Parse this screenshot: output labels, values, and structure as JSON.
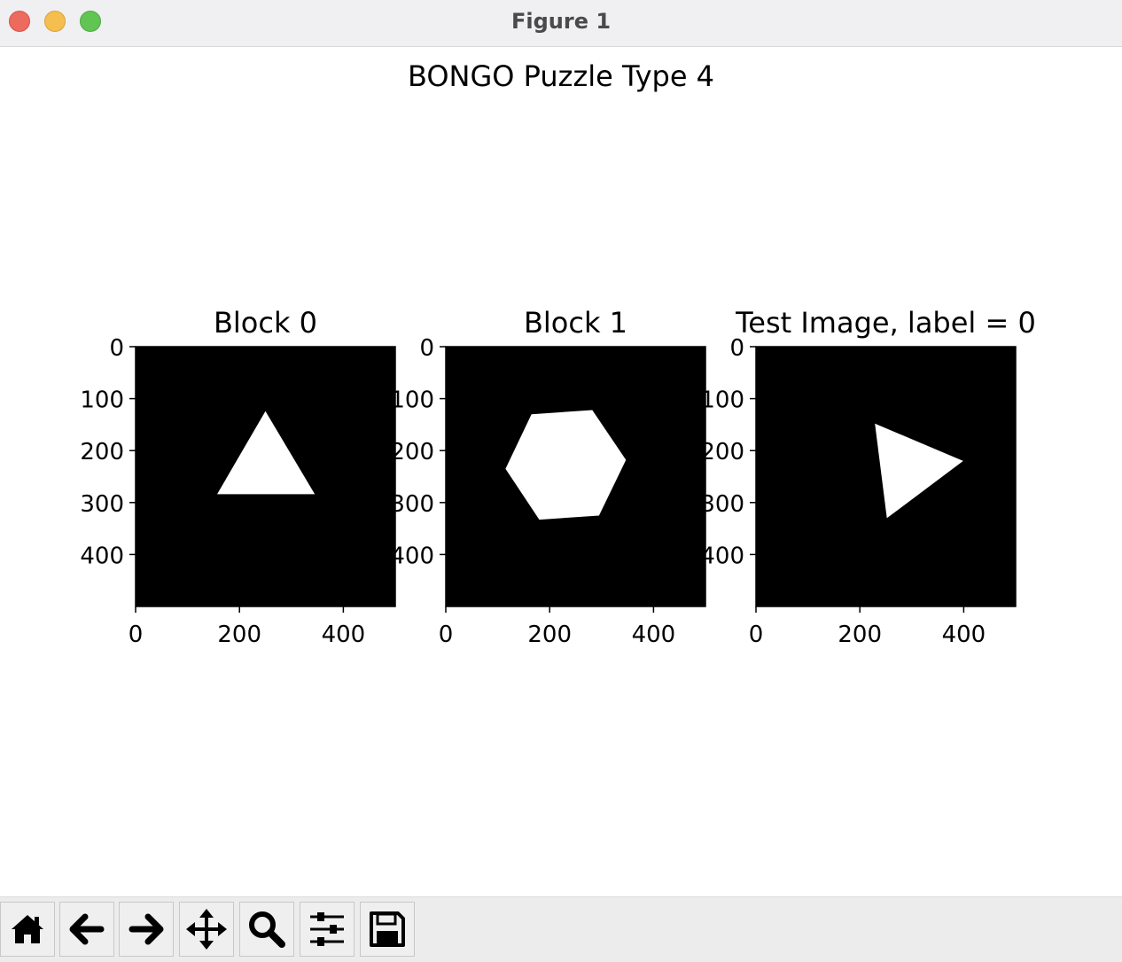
{
  "window": {
    "title": "Figure 1"
  },
  "figure": {
    "suptitle": "BONGO Puzzle Type 4",
    "panels": [
      {
        "title": "Block 0",
        "shape": "triangle-up",
        "polygon": [
          [
            250,
            124
          ],
          [
            345,
            284
          ],
          [
            157,
            284
          ]
        ]
      },
      {
        "title": "Block 1",
        "shape": "hexagon",
        "polygon": [
          [
            165,
            130
          ],
          [
            282,
            122
          ],
          [
            347,
            218
          ],
          [
            295,
            325
          ],
          [
            180,
            333
          ],
          [
            115,
            235
          ]
        ]
      },
      {
        "title": "Test Image, label = 0",
        "shape": "triangle-right",
        "polygon": [
          [
            229,
            148
          ],
          [
            399,
            220
          ],
          [
            252,
            330
          ]
        ]
      }
    ],
    "xticks": [
      "0",
      "200",
      "400"
    ],
    "yticks": [
      "0",
      "100",
      "200",
      "300",
      "400"
    ],
    "image_size": [
      500,
      500
    ],
    "colors": {
      "background": "#000000",
      "shape": "#ffffff"
    }
  },
  "chart_data": [
    {
      "type": "image",
      "title": "Block 0",
      "xlim": [
        0,
        500
      ],
      "ylim": [
        500,
        0
      ],
      "x_ticks": [
        0,
        200,
        400
      ],
      "y_ticks": [
        0,
        100,
        200,
        300,
        400
      ],
      "shape": "triangle"
    },
    {
      "type": "image",
      "title": "Block 1",
      "xlim": [
        0,
        500
      ],
      "ylim": [
        500,
        0
      ],
      "x_ticks": [
        0,
        200,
        400
      ],
      "y_ticks": [
        0,
        100,
        200,
        300,
        400
      ],
      "shape": "hexagon"
    },
    {
      "type": "image",
      "title": "Test Image, label = 0",
      "xlim": [
        0,
        500
      ],
      "ylim": [
        500,
        0
      ],
      "x_ticks": [
        0,
        200,
        400
      ],
      "y_ticks": [
        0,
        100,
        200,
        300,
        400
      ],
      "shape": "triangle"
    }
  ],
  "toolbar": {
    "buttons": [
      {
        "name": "home-button",
        "icon": "home-icon"
      },
      {
        "name": "back-button",
        "icon": "arrow-left-icon"
      },
      {
        "name": "forward-button",
        "icon": "arrow-right-icon"
      },
      {
        "name": "pan-button",
        "icon": "move-icon"
      },
      {
        "name": "zoom-button",
        "icon": "magnifier-icon"
      },
      {
        "name": "configure-subplots-button",
        "icon": "sliders-icon"
      },
      {
        "name": "save-button",
        "icon": "floppy-disk-icon"
      }
    ]
  }
}
